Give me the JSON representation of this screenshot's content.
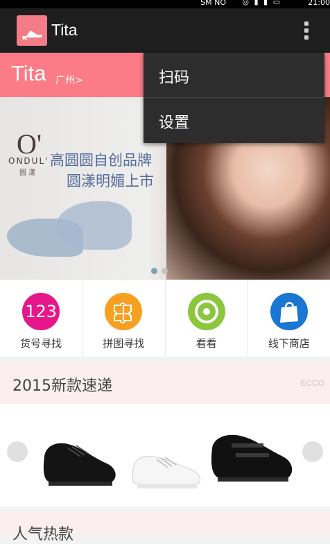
{
  "status_bar": {
    "text": "SM NO",
    "time": "21:00",
    "icons": "◎ ▮ ▮ ▭"
  },
  "action_bar": {
    "title": "Tita",
    "icon": "high-heel-icon",
    "overflow_icon": "more-vert-icon"
  },
  "menu": {
    "items": [
      {
        "label": "扫码"
      },
      {
        "label": "设置"
      }
    ]
  },
  "header": {
    "brand": "Tita",
    "city": "广州>"
  },
  "banner": {
    "logo_mark": "O'",
    "logo_text": "ONDUL'",
    "logo_sub": "圆 漾",
    "line1": "高圆圆自创品牌",
    "line2": "圆漾明媚上市",
    "accent": "#556b9c"
  },
  "quick_nav": [
    {
      "label": "货号寻找",
      "icon": "number-123-icon",
      "icon_text": "123",
      "color": "#e5178a"
    },
    {
      "label": "拼图寻找",
      "icon": "puzzle-icon",
      "color": "#f6a021"
    },
    {
      "label": "看看",
      "icon": "eye-target-icon",
      "color": "#8cc63f"
    },
    {
      "label": "线下商店",
      "icon": "shopping-bag-icon",
      "color": "#1976d2"
    }
  ],
  "sections": [
    {
      "title": "2015新款速递",
      "brand": "ECCO"
    },
    {
      "title": "人气热款"
    }
  ],
  "colors": {
    "header_pink": "#fb7c86",
    "action_bar": "#1e1e1e",
    "section_bg": "#fbeeee"
  }
}
